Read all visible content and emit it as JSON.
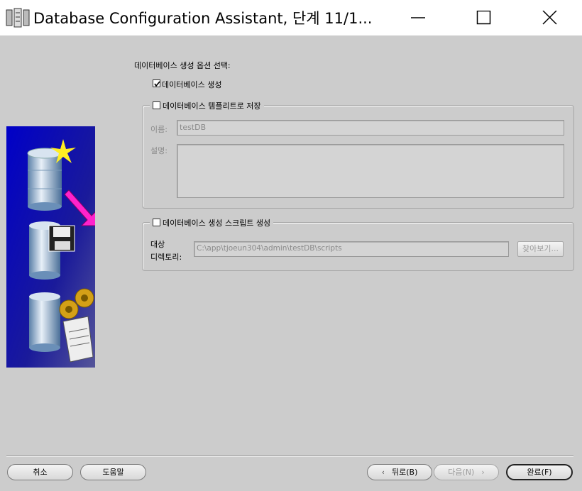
{
  "window": {
    "title": "Database Configuration Assistant, 단계 11/1...",
    "controls": {
      "minimize": "minimize",
      "maximize": "maximize",
      "close": "close"
    }
  },
  "main": {
    "section_title": "데이터베이스 생성 옵션 선택:",
    "create_db": {
      "label": "데이터베이스 생성",
      "checked": true
    },
    "save_template": {
      "label": "데이터베이스 템플리트로 저장",
      "checked": false,
      "name_label": "이름:",
      "name_value": "testDB",
      "desc_label": "설명:",
      "desc_value": ""
    },
    "gen_scripts": {
      "label": "데이터베이스 생성 스크립트 생성",
      "checked": false,
      "dest_label_line1": "대상",
      "dest_label_line2": "디렉토리:",
      "dest_value": "C:\\app\\tjoeun304\\admin\\testDB\\scripts",
      "browse_label": "찾아보기..."
    }
  },
  "footer": {
    "cancel_label": "취소",
    "help_label": "도움말",
    "back_label": "뒤로(B)",
    "next_label": "다음(N)",
    "finish_label": "완료(F)"
  },
  "icons": {
    "app": "database-app-icon",
    "side_image": "database-wizard-illustration"
  }
}
